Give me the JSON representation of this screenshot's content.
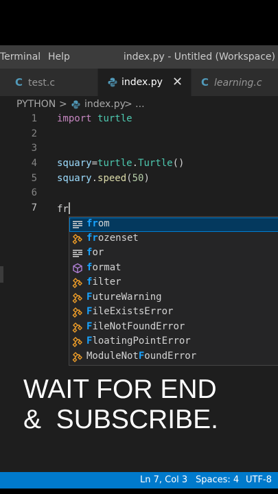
{
  "titlebar": {
    "menu": [
      "Terminal",
      "Help"
    ],
    "title": "index.py - Untitled (Workspace)"
  },
  "tabs": [
    {
      "label": "test.c",
      "icon": "C"
    },
    {
      "label": "index.py",
      "close": "✕"
    },
    {
      "label": "learning.c",
      "icon": "C"
    }
  ],
  "breadcrumb": {
    "root": "PYTHON",
    "sep": ">",
    "file": "index.py",
    "more": "> ..."
  },
  "code": {
    "line_numbers": [
      "1",
      "2",
      "3",
      "4",
      "5",
      "6",
      "7"
    ],
    "lines": [
      {
        "kw": "import",
        "mod": "turtle"
      },
      {
        "var": "squary",
        "eq": "=",
        "mod": "turtle",
        "dot": ".",
        "cls": "Turtle",
        "paren": "()"
      },
      {
        "var": "squary",
        "dot": ".",
        "fn": "speed",
        "open": "(",
        "num": "50",
        "close": ")"
      },
      {
        "typed": "fr"
      }
    ]
  },
  "suggestions": [
    {
      "pre": "",
      "hl": "fr",
      "post": "om",
      "icon": "keyword-icon"
    },
    {
      "pre": "",
      "hl": "fr",
      "post": "ozenset",
      "icon": "class-icon"
    },
    {
      "pre": "f",
      "hl": "",
      "post": "or",
      "icon": "keyword-icon"
    },
    {
      "pre": "f",
      "hl": "",
      "post": "ormat",
      "icon": "function-icon"
    },
    {
      "pre": "f",
      "hl": "",
      "post": "ilter",
      "icon": "class-icon"
    },
    {
      "pre": "F",
      "hl": "",
      "post": "utureWarning",
      "icon": "class-icon"
    },
    {
      "pre": "F",
      "hl": "",
      "post": "ileExistsError",
      "icon": "class-icon"
    },
    {
      "pre": "F",
      "hl": "",
      "post": "ileNotFoundError",
      "icon": "class-icon"
    },
    {
      "pre": "F",
      "hl": "",
      "post": "loatingPointError",
      "icon": "class-icon"
    },
    {
      "pre": "ModuleNot",
      "hl": "F",
      "post": "oundError",
      "icon": "class-icon"
    }
  ],
  "overlay": {
    "line1": "WAIT FOR END",
    "line2": "&  SUBSCRIBE."
  },
  "status": {
    "position": "Ln 7, Col 3",
    "spaces": "Spaces: 4",
    "encoding": "UTF-8"
  },
  "colors": {
    "accent": "#007acc",
    "keyword": "#c586c0",
    "type": "#4ec9b0",
    "variable": "#9cdcfe",
    "match": "#18a3ff"
  }
}
